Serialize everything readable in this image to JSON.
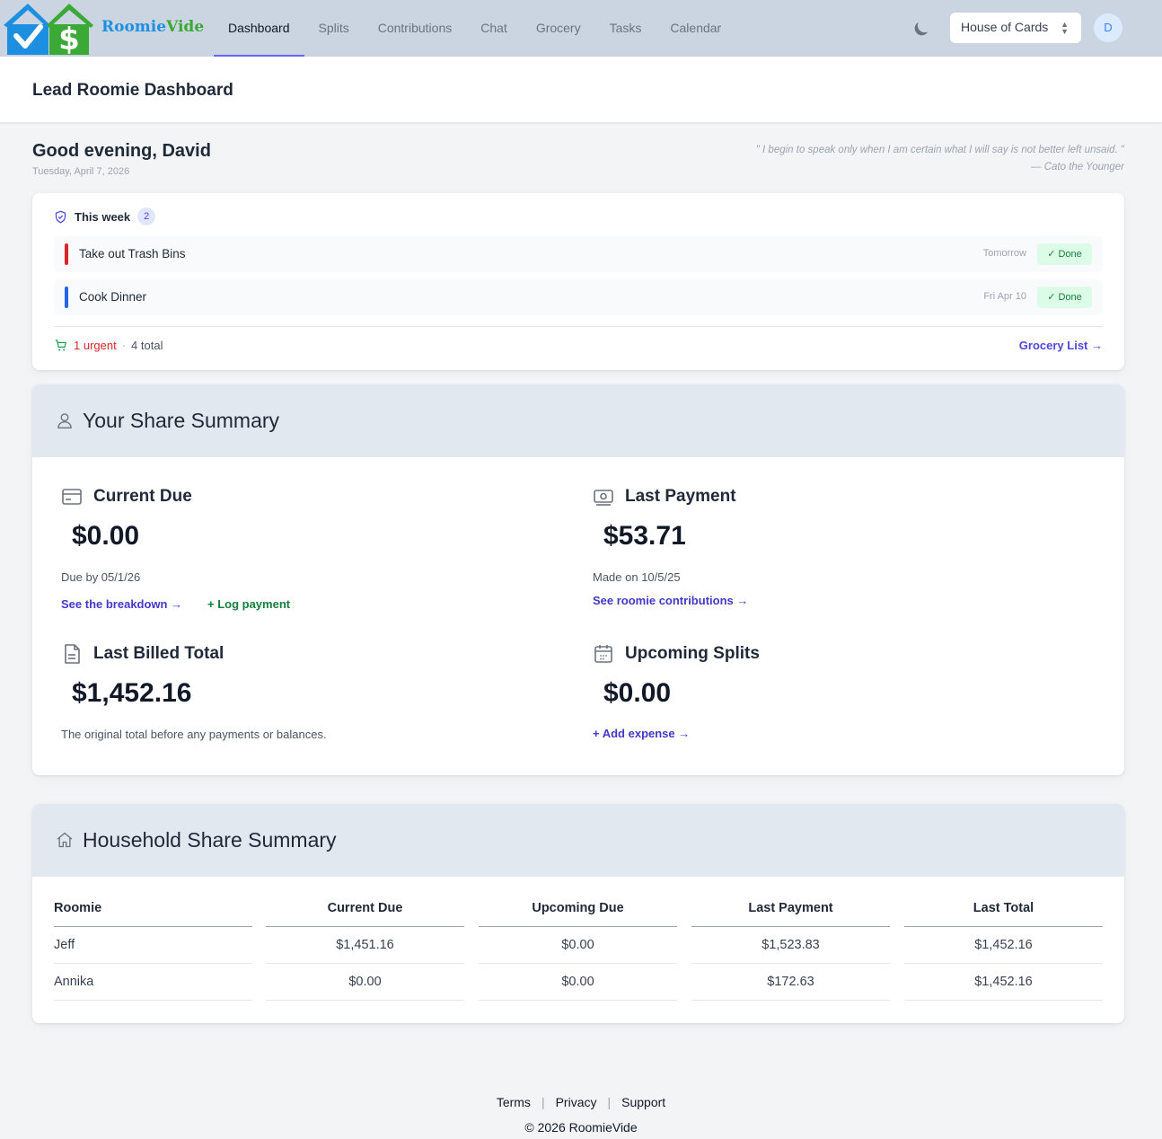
{
  "brand": {
    "part1": "Roomie",
    "part2": "Vide"
  },
  "nav": {
    "items": [
      {
        "label": "Dashboard",
        "active": true
      },
      {
        "label": "Splits"
      },
      {
        "label": "Contributions"
      },
      {
        "label": "Chat"
      },
      {
        "label": "Grocery"
      },
      {
        "label": "Tasks"
      },
      {
        "label": "Calendar"
      }
    ],
    "house_select": "House of Cards",
    "avatar_initial": "D"
  },
  "page": {
    "title": "Lead Roomie Dashboard",
    "greeting": "Good evening, David",
    "date": "Tuesday, April 7, 2026",
    "quote": "\" I begin to speak only when I am certain what I will say is not better left unsaid. \" — Cato the Younger"
  },
  "week": {
    "label": "This week",
    "count": "2",
    "tasks": [
      {
        "name": "Take out Trash Bins",
        "due": "Tomorrow",
        "status": "✓ Done",
        "color": "#dc2626"
      },
      {
        "name": "Cook Dinner",
        "due": "Fri Apr 10",
        "status": "✓ Done",
        "color": "#2563eb"
      }
    ],
    "urgent": "1 urgent",
    "sep": "·",
    "total": "4 total",
    "grocery_link": "Grocery List →"
  },
  "share": {
    "title": "Your Share Summary",
    "current_due": {
      "label": "Current Due",
      "value": "$0.00",
      "sub": "Due by 05/1/26",
      "link1": "See the breakdown →",
      "link2": "+ Log payment"
    },
    "last_payment": {
      "label": "Last Payment",
      "value": "$53.71",
      "sub": "Made on 10/5/25",
      "link": "See roomie contributions →"
    },
    "last_billed": {
      "label": "Last Billed Total",
      "value": "$1,452.16",
      "sub": "The original total before any payments or balances."
    },
    "upcoming": {
      "label": "Upcoming Splits",
      "value": "$0.00",
      "link": "+ Add expense →"
    }
  },
  "household": {
    "title": "Household Share Summary",
    "headers": [
      "Roomie",
      "Current Due",
      "Upcoming Due",
      "Last Payment",
      "Last Total"
    ],
    "rows": [
      {
        "roomie": "Jeff",
        "current": "$1,451.16",
        "upcoming": "$0.00",
        "last_payment": "$1,523.83",
        "last_total": "$1,452.16",
        "current_status": "owing"
      },
      {
        "roomie": "Annika",
        "current": "$0.00",
        "upcoming": "$0.00",
        "last_payment": "$172.63",
        "last_total": "$1,452.16",
        "current_status": "paid"
      }
    ]
  },
  "footer": {
    "links": [
      "Terms",
      "Privacy",
      "Support"
    ],
    "separator": "|",
    "copyright": "© 2026 RoomieVide"
  },
  "colors": {
    "accent": "#4f46e5",
    "nav_bg": "#cbd5e1",
    "section_bg": "#e2e8f0",
    "owing": "#dc2626",
    "paid": "#16a34a"
  }
}
